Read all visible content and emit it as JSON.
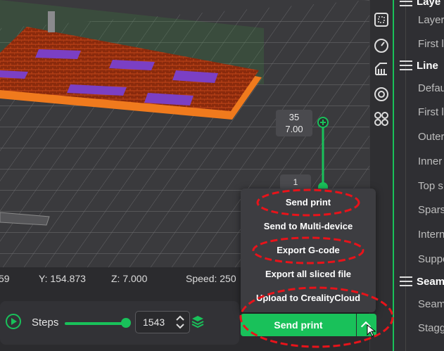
{
  "viewport": {
    "layer_top_value": "35",
    "layer_top_height": "7.00",
    "layer_bottom_value": "1"
  },
  "status_bar": {
    "x_readout": "59",
    "y_readout": "Y: 154.873",
    "z_readout": "Z: 7.000",
    "speed_readout": "Speed: 250"
  },
  "bottom_bar": {
    "steps_label": "Steps",
    "steps_value": "1543",
    "slider_fraction": 1.0
  },
  "export_menu": {
    "items": [
      "Send print",
      "Send to Multi-device",
      "Export G-code",
      "Export all sliced file",
      "Upload to CrealityCloud"
    ]
  },
  "send_button": {
    "label": "Send print"
  },
  "settings_panel": {
    "sections": [
      {
        "title": "Laye",
        "items": [
          "Layer",
          "First l"
        ]
      },
      {
        "title": "Line",
        "items": [
          "Defau",
          "First l",
          "Outer",
          "Inner",
          "Top s",
          "Spars",
          "Intern",
          "Suppo"
        ]
      },
      {
        "title": "Seam",
        "items": [
          "Seam",
          "Stagg"
        ]
      }
    ]
  },
  "toolbar_icons": [
    "layout-icon",
    "speedometer-icon",
    "support-icon",
    "seam-icon",
    "plugin-icon"
  ],
  "colors": {
    "accent": "#19c15a",
    "annotation": "#e8131a",
    "model_body": "#8a2a0c",
    "model_edge": "#f07a1d",
    "model_top": "#7b3fc4"
  }
}
